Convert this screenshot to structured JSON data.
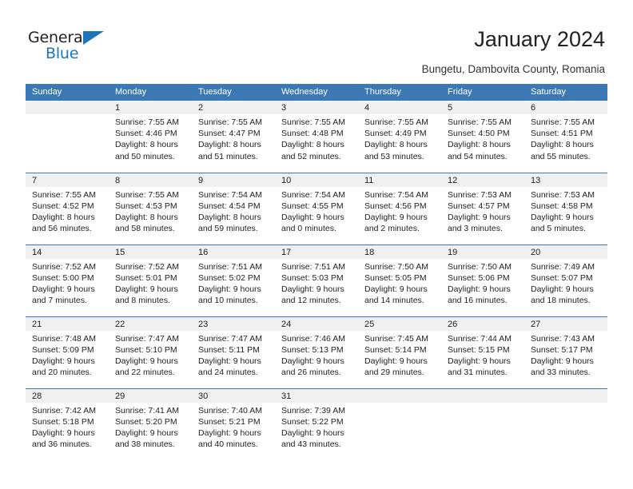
{
  "brand": {
    "name_part1": "General",
    "name_part2": "Blue",
    "triangle_icon": "triangle-icon",
    "accent_color": "#1b75bb"
  },
  "header": {
    "title": "January 2024",
    "subtitle": "Bungetu, Dambovita County, Romania"
  },
  "calendar": {
    "header_bg_color": "#3c78b4",
    "daynum_bg_color": "#f0f0f0",
    "weekday_headers": [
      "Sunday",
      "Monday",
      "Tuesday",
      "Wednesday",
      "Thursday",
      "Friday",
      "Saturday"
    ],
    "weeks": [
      [
        {
          "day": "",
          "empty": true,
          "sunrise": "",
          "sunset": "",
          "daylight_line1": "",
          "daylight_line2": ""
        },
        {
          "day": "1",
          "sunrise": "Sunrise: 7:55 AM",
          "sunset": "Sunset: 4:46 PM",
          "daylight_line1": "Daylight: 8 hours",
          "daylight_line2": "and 50 minutes."
        },
        {
          "day": "2",
          "sunrise": "Sunrise: 7:55 AM",
          "sunset": "Sunset: 4:47 PM",
          "daylight_line1": "Daylight: 8 hours",
          "daylight_line2": "and 51 minutes."
        },
        {
          "day": "3",
          "sunrise": "Sunrise: 7:55 AM",
          "sunset": "Sunset: 4:48 PM",
          "daylight_line1": "Daylight: 8 hours",
          "daylight_line2": "and 52 minutes."
        },
        {
          "day": "4",
          "sunrise": "Sunrise: 7:55 AM",
          "sunset": "Sunset: 4:49 PM",
          "daylight_line1": "Daylight: 8 hours",
          "daylight_line2": "and 53 minutes."
        },
        {
          "day": "5",
          "sunrise": "Sunrise: 7:55 AM",
          "sunset": "Sunset: 4:50 PM",
          "daylight_line1": "Daylight: 8 hours",
          "daylight_line2": "and 54 minutes."
        },
        {
          "day": "6",
          "sunrise": "Sunrise: 7:55 AM",
          "sunset": "Sunset: 4:51 PM",
          "daylight_line1": "Daylight: 8 hours",
          "daylight_line2": "and 55 minutes."
        }
      ],
      [
        {
          "day": "7",
          "sunrise": "Sunrise: 7:55 AM",
          "sunset": "Sunset: 4:52 PM",
          "daylight_line1": "Daylight: 8 hours",
          "daylight_line2": "and 56 minutes."
        },
        {
          "day": "8",
          "sunrise": "Sunrise: 7:55 AM",
          "sunset": "Sunset: 4:53 PM",
          "daylight_line1": "Daylight: 8 hours",
          "daylight_line2": "and 58 minutes."
        },
        {
          "day": "9",
          "sunrise": "Sunrise: 7:54 AM",
          "sunset": "Sunset: 4:54 PM",
          "daylight_line1": "Daylight: 8 hours",
          "daylight_line2": "and 59 minutes."
        },
        {
          "day": "10",
          "sunrise": "Sunrise: 7:54 AM",
          "sunset": "Sunset: 4:55 PM",
          "daylight_line1": "Daylight: 9 hours",
          "daylight_line2": "and 0 minutes."
        },
        {
          "day": "11",
          "sunrise": "Sunrise: 7:54 AM",
          "sunset": "Sunset: 4:56 PM",
          "daylight_line1": "Daylight: 9 hours",
          "daylight_line2": "and 2 minutes."
        },
        {
          "day": "12",
          "sunrise": "Sunrise: 7:53 AM",
          "sunset": "Sunset: 4:57 PM",
          "daylight_line1": "Daylight: 9 hours",
          "daylight_line2": "and 3 minutes."
        },
        {
          "day": "13",
          "sunrise": "Sunrise: 7:53 AM",
          "sunset": "Sunset: 4:58 PM",
          "daylight_line1": "Daylight: 9 hours",
          "daylight_line2": "and 5 minutes."
        }
      ],
      [
        {
          "day": "14",
          "sunrise": "Sunrise: 7:52 AM",
          "sunset": "Sunset: 5:00 PM",
          "daylight_line1": "Daylight: 9 hours",
          "daylight_line2": "and 7 minutes."
        },
        {
          "day": "15",
          "sunrise": "Sunrise: 7:52 AM",
          "sunset": "Sunset: 5:01 PM",
          "daylight_line1": "Daylight: 9 hours",
          "daylight_line2": "and 8 minutes."
        },
        {
          "day": "16",
          "sunrise": "Sunrise: 7:51 AM",
          "sunset": "Sunset: 5:02 PM",
          "daylight_line1": "Daylight: 9 hours",
          "daylight_line2": "and 10 minutes."
        },
        {
          "day": "17",
          "sunrise": "Sunrise: 7:51 AM",
          "sunset": "Sunset: 5:03 PM",
          "daylight_line1": "Daylight: 9 hours",
          "daylight_line2": "and 12 minutes."
        },
        {
          "day": "18",
          "sunrise": "Sunrise: 7:50 AM",
          "sunset": "Sunset: 5:05 PM",
          "daylight_line1": "Daylight: 9 hours",
          "daylight_line2": "and 14 minutes."
        },
        {
          "day": "19",
          "sunrise": "Sunrise: 7:50 AM",
          "sunset": "Sunset: 5:06 PM",
          "daylight_line1": "Daylight: 9 hours",
          "daylight_line2": "and 16 minutes."
        },
        {
          "day": "20",
          "sunrise": "Sunrise: 7:49 AM",
          "sunset": "Sunset: 5:07 PM",
          "daylight_line1": "Daylight: 9 hours",
          "daylight_line2": "and 18 minutes."
        }
      ],
      [
        {
          "day": "21",
          "sunrise": "Sunrise: 7:48 AM",
          "sunset": "Sunset: 5:09 PM",
          "daylight_line1": "Daylight: 9 hours",
          "daylight_line2": "and 20 minutes."
        },
        {
          "day": "22",
          "sunrise": "Sunrise: 7:47 AM",
          "sunset": "Sunset: 5:10 PM",
          "daylight_line1": "Daylight: 9 hours",
          "daylight_line2": "and 22 minutes."
        },
        {
          "day": "23",
          "sunrise": "Sunrise: 7:47 AM",
          "sunset": "Sunset: 5:11 PM",
          "daylight_line1": "Daylight: 9 hours",
          "daylight_line2": "and 24 minutes."
        },
        {
          "day": "24",
          "sunrise": "Sunrise: 7:46 AM",
          "sunset": "Sunset: 5:13 PM",
          "daylight_line1": "Daylight: 9 hours",
          "daylight_line2": "and 26 minutes."
        },
        {
          "day": "25",
          "sunrise": "Sunrise: 7:45 AM",
          "sunset": "Sunset: 5:14 PM",
          "daylight_line1": "Daylight: 9 hours",
          "daylight_line2": "and 29 minutes."
        },
        {
          "day": "26",
          "sunrise": "Sunrise: 7:44 AM",
          "sunset": "Sunset: 5:15 PM",
          "daylight_line1": "Daylight: 9 hours",
          "daylight_line2": "and 31 minutes."
        },
        {
          "day": "27",
          "sunrise": "Sunrise: 7:43 AM",
          "sunset": "Sunset: 5:17 PM",
          "daylight_line1": "Daylight: 9 hours",
          "daylight_line2": "and 33 minutes."
        }
      ],
      [
        {
          "day": "28",
          "sunrise": "Sunrise: 7:42 AM",
          "sunset": "Sunset: 5:18 PM",
          "daylight_line1": "Daylight: 9 hours",
          "daylight_line2": "and 36 minutes."
        },
        {
          "day": "29",
          "sunrise": "Sunrise: 7:41 AM",
          "sunset": "Sunset: 5:20 PM",
          "daylight_line1": "Daylight: 9 hours",
          "daylight_line2": "and 38 minutes."
        },
        {
          "day": "30",
          "sunrise": "Sunrise: 7:40 AM",
          "sunset": "Sunset: 5:21 PM",
          "daylight_line1": "Daylight: 9 hours",
          "daylight_line2": "and 40 minutes."
        },
        {
          "day": "31",
          "sunrise": "Sunrise: 7:39 AM",
          "sunset": "Sunset: 5:22 PM",
          "daylight_line1": "Daylight: 9 hours",
          "daylight_line2": "and 43 minutes."
        },
        {
          "day": "",
          "empty": true,
          "sunrise": "",
          "sunset": "",
          "daylight_line1": "",
          "daylight_line2": ""
        },
        {
          "day": "",
          "empty": true,
          "sunrise": "",
          "sunset": "",
          "daylight_line1": "",
          "daylight_line2": ""
        },
        {
          "day": "",
          "empty": true,
          "sunrise": "",
          "sunset": "",
          "daylight_line1": "",
          "daylight_line2": ""
        }
      ]
    ]
  }
}
